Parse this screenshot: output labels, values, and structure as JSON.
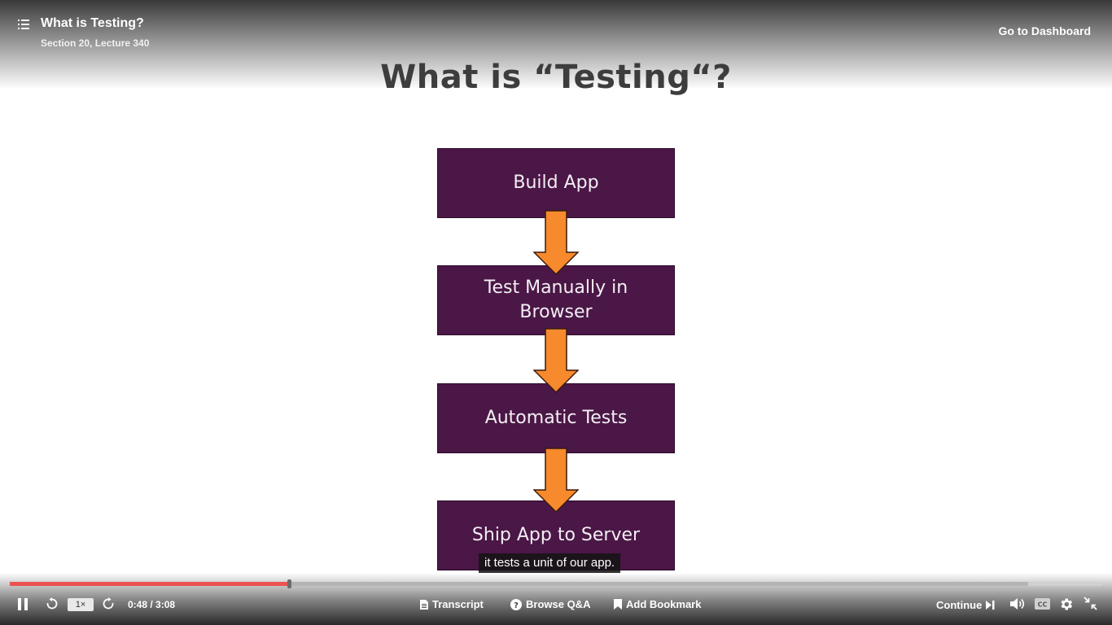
{
  "header": {
    "lecture_title": "What is Testing?",
    "lecture_subtitle": "Section 20, Lecture 340",
    "dashboard_link": "Go to Dashboard"
  },
  "slide": {
    "title": "What is “Testing“?",
    "steps": [
      "Build App",
      "Test Manually in Browser",
      "Automatic Tests",
      "Ship App to Server"
    ],
    "box_color": "#4a1746",
    "arrow_color": "#f68a2c"
  },
  "caption": "it tests a unit of our app.",
  "player": {
    "progress_fraction": 0.2553,
    "buffered_fraction": 0.932,
    "current_time": "0:48",
    "duration": "3:08",
    "time_display": "0:48 / 3:08",
    "speed": "1×",
    "progress_color": "#ec5252",
    "transcript_label": "Transcript",
    "qa_label": "Browse Q&A",
    "bookmark_label": "Add Bookmark",
    "continue_label": "Continue",
    "icons": [
      "pause-icon",
      "rewind-icon",
      "forward-icon",
      "transcript-icon",
      "question-icon",
      "bookmark-icon",
      "next-icon",
      "volume-icon",
      "captions-icon",
      "settings-icon",
      "exit-fullscreen-icon",
      "list-icon"
    ]
  }
}
